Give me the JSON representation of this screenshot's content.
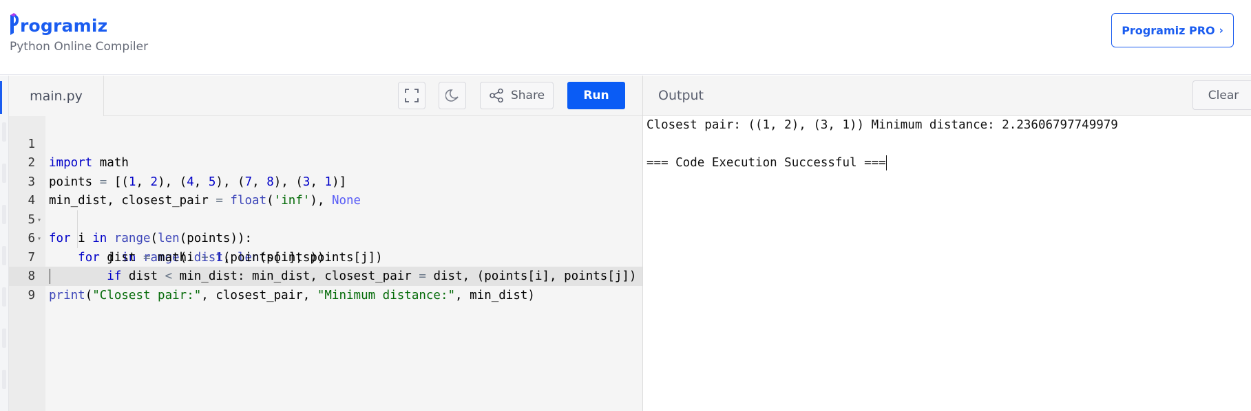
{
  "header": {
    "logo_text": "rogramiz",
    "subtitle": "Python Online Compiler",
    "pro_button": "Programiz PRO",
    "pro_chevron": "›",
    "accent": "#1a5cf0"
  },
  "editor": {
    "tab_label": "main.py",
    "fullscreen_icon": "fullscreen-icon",
    "theme_icon": "moon-icon",
    "share_label": "Share",
    "share_icon": "share-icon",
    "run_label": "Run",
    "run_color": "#0a5cf5",
    "line_numbers": [
      "1",
      "2",
      "3",
      "4",
      "5",
      "6",
      "7",
      "8",
      "9"
    ],
    "code_lines": [
      "import math",
      "points = [(1, 2), (4, 5), (7, 8), (3, 1)]",
      "min_dist, closest_pair = float('inf'), None",
      "for i in range(len(points)):",
      "    for j in range(i + 1, len(points)):",
      "        dist = math.dist(points[i], points[j])",
      "        if dist < min_dist: min_dist, closest_pair = dist, (points[i], points[j])",
      "print(\"Closest pair:\", closest_pair, \"Minimum distance:\", min_dist)",
      ""
    ],
    "active_line": 9
  },
  "output": {
    "title": "Output",
    "clear_label": "Clear",
    "lines": [
      "Closest pair: ((1, 2), (3, 1)) Minimum distance: 2.23606797749979",
      "",
      "=== Code Execution Successful ==="
    ]
  }
}
